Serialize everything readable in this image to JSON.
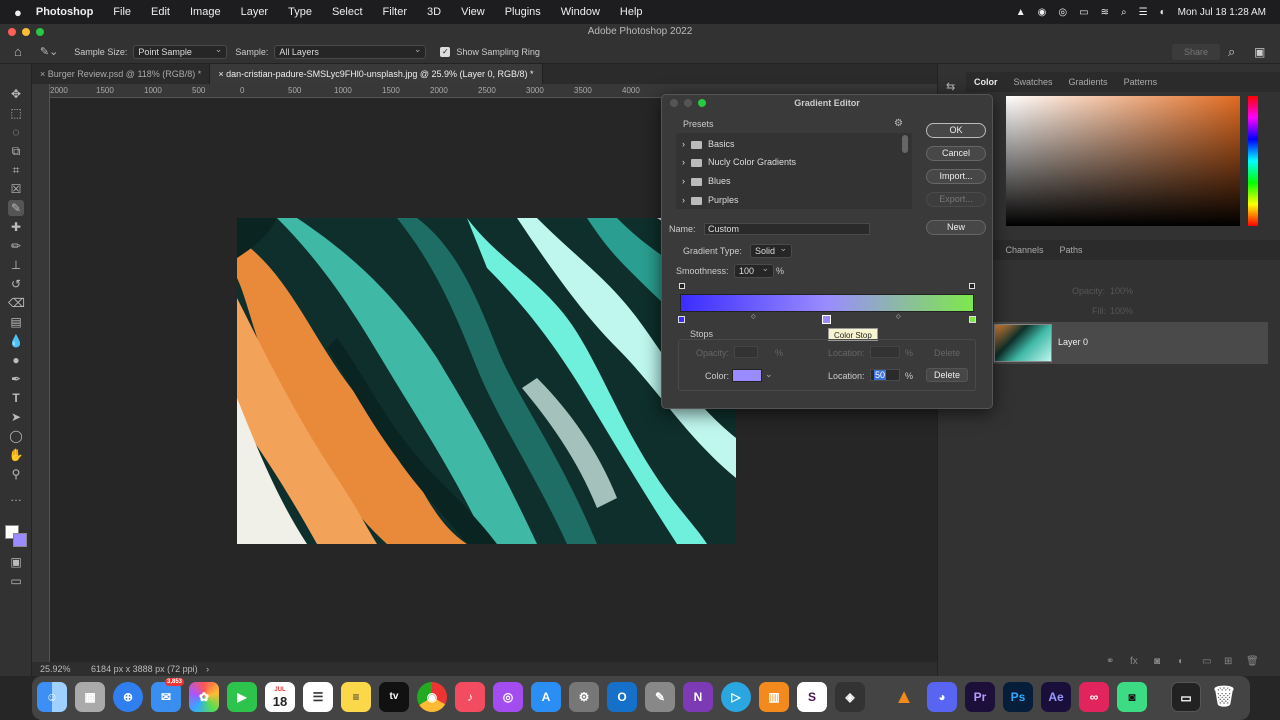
{
  "menubar": {
    "app": "Photoshop",
    "items": [
      "File",
      "Edit",
      "Image",
      "Layer",
      "Type",
      "Select",
      "Filter",
      "3D",
      "View",
      "Plugins",
      "Window",
      "Help"
    ],
    "clock": "Mon Jul 18  1:28 AM"
  },
  "window_title": "Adobe Photoshop 2022",
  "options_bar": {
    "sample_size_label": "Sample Size:",
    "sample_size_value": "Point Sample",
    "sample_label": "Sample:",
    "sample_value": "All Layers",
    "show_ring_label": "Show Sampling Ring",
    "share_label": "Share"
  },
  "document_tabs": [
    {
      "label": "Burger Review.psd @ 118% (RGB/8) *"
    },
    {
      "label": "dan-cristian-padure-SMSLyc9FHl0-unsplash.jpg @ 25.9% (Layer 0, RGB/8) *"
    }
  ],
  "ruler_top": [
    "2000",
    "1500",
    "1000",
    "500",
    "0",
    "500",
    "1000",
    "1500",
    "2000",
    "2500",
    "3000",
    "3500",
    "4000"
  ],
  "status_bar": {
    "zoom": "25.92%",
    "dimensions": "6184 px x 3888 px (72 ppi)"
  },
  "right_panels": {
    "top_tabs": [
      "Color",
      "Swatches",
      "Gradients",
      "Patterns"
    ],
    "mid_tabs": [
      "rs",
      "Channels",
      "Paths"
    ],
    "opacity_label": "Opacity:",
    "opacity_value": "100%",
    "fill_label": "Fill:",
    "fill_value": "100%",
    "layer_name": "Layer 0"
  },
  "gradient_editor": {
    "title": "Gradient Editor",
    "presets_label": "Presets",
    "presets": [
      "Basics",
      "Nucly Color Gradients",
      "Blues",
      "Purples"
    ],
    "buttons": {
      "ok": "OK",
      "cancel": "Cancel",
      "import": "Import...",
      "export": "Export...",
      "new": "New"
    },
    "name_label": "Name:",
    "name_value": "Custom",
    "gradient_type_label": "Gradient Type:",
    "gradient_type_value": "Solid",
    "smoothness_label": "Smoothness:",
    "smoothness_value": "100",
    "percent": "%",
    "stops_label": "Stops",
    "opacity_label": "Opacity:",
    "location_label": "Location:",
    "delete_label": "Delete",
    "color_label": "Color:",
    "color_location_value": "50",
    "tooltip": "Color Stop",
    "gradient_start": "#3b2cff",
    "gradient_end": "#7ee84a",
    "stop_color": "#9a8cff"
  },
  "dock_apps": [
    "Finder",
    "Launchpad",
    "Safari",
    "Mail",
    "Photos",
    "FaceTime",
    "Calendar",
    "Reminders",
    "Notes",
    "TV",
    "Chrome",
    "Music",
    "Podcasts",
    "App Store",
    "System Preferences",
    "Outlook",
    "Script Editor",
    "OneNote",
    "Visual",
    "Books",
    "Slack",
    "DaVinci",
    "VLC",
    "Discord",
    "Premiere",
    "Photoshop",
    "After Effects",
    "Creative Cloud",
    "Android",
    "Screen",
    "Trash"
  ],
  "dock_badge_mail": "3,853",
  "dock_calendar": {
    "month": "JUL",
    "day": "18"
  }
}
